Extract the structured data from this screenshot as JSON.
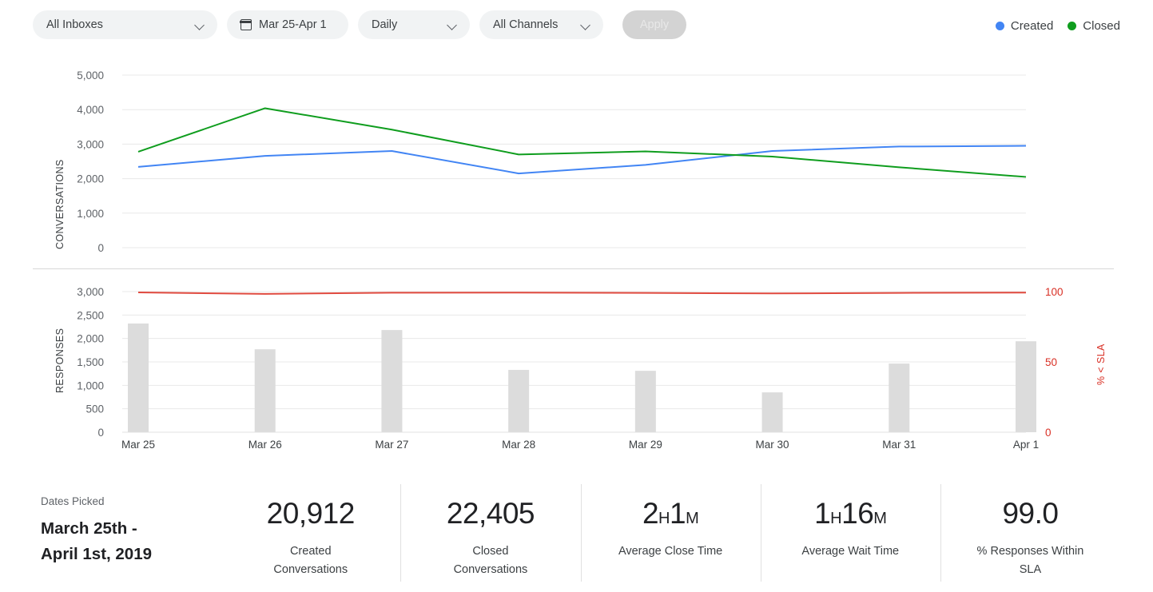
{
  "filters": {
    "inbox": {
      "label": "All Inboxes",
      "icon": "chevron-down-icon"
    },
    "date": {
      "label": "Mar 25-Apr 1",
      "icon": "calendar-icon"
    },
    "granularity": {
      "label": "Daily",
      "icon": "chevron-down-icon"
    },
    "channel": {
      "label": "All Channels",
      "icon": "chevron-down-icon"
    },
    "apply": {
      "label": "Apply"
    }
  },
  "legend": [
    {
      "label": "Created",
      "color": "#4285f4"
    },
    {
      "label": "Closed",
      "color": "#0f9d1e"
    }
  ],
  "chart_data": [
    {
      "type": "line",
      "title": "",
      "xlabel": "",
      "ylabel": "CONVERSATIONS",
      "categories": [
        "Mar 25",
        "Mar 26",
        "Mar 27",
        "Mar 28",
        "Mar 29",
        "Mar 30",
        "Mar 31",
        "Apr 1"
      ],
      "yticks": [
        "0",
        "1,000",
        "2,000",
        "3,000",
        "4,000",
        "5,000"
      ],
      "ylim": [
        0,
        5000
      ],
      "grid": true,
      "legend_position": "top-right",
      "series": [
        {
          "name": "Created",
          "color": "#4285f4",
          "values": [
            2340,
            2660,
            2800,
            2150,
            2400,
            2800,
            2930,
            2950
          ]
        },
        {
          "name": "Closed",
          "color": "#0f9d1e",
          "values": [
            2780,
            4040,
            3420,
            2700,
            2790,
            2640,
            2330,
            2050
          ]
        }
      ]
    },
    {
      "type": "bar",
      "title": "",
      "xlabel": "",
      "ylabel": "RESPONSES",
      "y2label": "% < SLA",
      "categories": [
        "Mar 25",
        "Mar 26",
        "Mar 27",
        "Mar 28",
        "Mar 29",
        "Mar 30",
        "Mar 31",
        "Apr 1"
      ],
      "yticks": [
        "0",
        "500",
        "1,000",
        "1,500",
        "2,000",
        "2,500",
        "3,000"
      ],
      "ylim": [
        0,
        3000
      ],
      "y2ticks": [
        "0",
        "50",
        "100"
      ],
      "y2lim": [
        0,
        100
      ],
      "grid": true,
      "bar_color": "#dcdcdc",
      "series": [
        {
          "name": "Responses",
          "type": "bar",
          "color": "#dcdcdc",
          "values": [
            2320,
            1770,
            2180,
            1330,
            1310,
            850,
            1465,
            1940
          ]
        },
        {
          "name": "% < SLA",
          "type": "line",
          "axis": "y2",
          "color": "#e04a3f",
          "values": [
            99.4,
            98.4,
            99.2,
            99.3,
            99.1,
            98.7,
            99.1,
            99.3
          ]
        }
      ]
    }
  ],
  "stats": {
    "dates_picked": {
      "title": "Dates Picked",
      "line1": "March 25th -",
      "line2": "April 1st, 2019"
    },
    "items": [
      {
        "value": "20,912",
        "label_line1": "Created",
        "label_line2": "Conversations"
      },
      {
        "value": "22,405",
        "label_line1": "Closed",
        "label_line2": "Conversations"
      },
      {
        "value_num1": "2",
        "value_unit1": "H",
        "value_num2": "1",
        "value_unit2": "M",
        "label_line1": "Average Close Time",
        "label_line2": ""
      },
      {
        "value_num1": "1",
        "value_unit1": "H",
        "value_num2": "16",
        "value_unit2": "M",
        "label_line1": "Average Wait Time",
        "label_line2": ""
      },
      {
        "value": "99.0",
        "label_line1": "% Responses Within",
        "label_line2": "SLA"
      }
    ]
  }
}
